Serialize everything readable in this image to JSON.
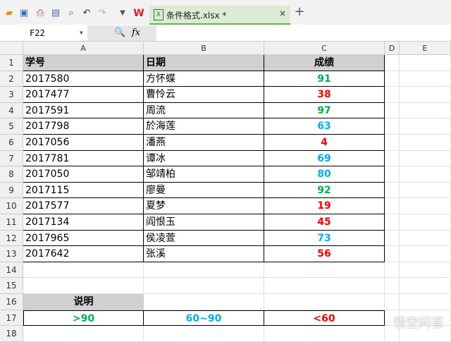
{
  "toolbar": {
    "icons": [
      "open-icon",
      "save-icon",
      "export-pdf-icon",
      "print-icon",
      "print-preview-icon",
      "undo-icon",
      "redo-icon",
      "dropdown-icon",
      "wps-logo"
    ],
    "tab_name": "条件格式.xlsx *",
    "close": "×",
    "new_tab": "+"
  },
  "formula_bar": {
    "name_box": "F22",
    "zoom_icon": "🔍",
    "fx": "fx",
    "value": ""
  },
  "columns": [
    "A",
    "B",
    "C",
    "D",
    "E"
  ],
  "rows": [
    "1",
    "2",
    "3",
    "4",
    "5",
    "6",
    "7",
    "8",
    "9",
    "10",
    "11",
    "12",
    "13",
    "14",
    "15",
    "16",
    "17",
    "18"
  ],
  "table": {
    "headers": [
      "学号",
      "日期",
      "成绩"
    ],
    "records": [
      [
        "2017580",
        "方怀蝶",
        "91"
      ],
      [
        "2017477",
        "曹怜云",
        "38"
      ],
      [
        "2017591",
        "周流",
        "97"
      ],
      [
        "2017798",
        "於海莲",
        "63"
      ],
      [
        "2017056",
        "潘燕",
        "4"
      ],
      [
        "2017781",
        "谭冰",
        "69"
      ],
      [
        "2017050",
        "邹靖柏",
        "80"
      ],
      [
        "2017115",
        "廖曼",
        "92"
      ],
      [
        "2017577",
        "夏梦",
        "19"
      ],
      [
        "2017134",
        "阎恨玉",
        "45"
      ],
      [
        "2017965",
        "侯凌萱",
        "73"
      ],
      [
        "2017642",
        "张溪",
        "56"
      ]
    ]
  },
  "legend": {
    "title": "说明",
    "items": [
      ">90",
      "60~90",
      "<60"
    ]
  },
  "colors": {
    "high": "#00b050",
    "mid": "#00b0f0",
    "low": "#ff0000",
    "header_bg": "#d0d0d0"
  },
  "watermark": "悟空问答"
}
